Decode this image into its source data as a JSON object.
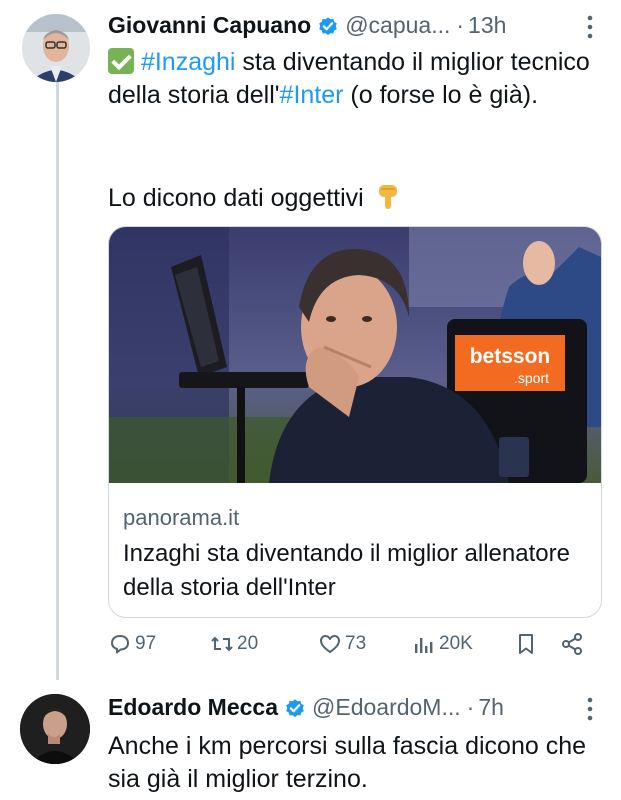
{
  "tweet": {
    "author_name": "Giovanni Capuano",
    "handle": "@capua...",
    "separator": "·",
    "time": "13h",
    "text": {
      "hashtag1": "#Inzaghi",
      "part1": " sta diventando il miglior tecnico della storia dell'",
      "hashtag2": "#Inter",
      "part2": " (o forse lo è già).",
      "line2": "Lo dicono dati oggettivi"
    },
    "card": {
      "image_badge": "betsson",
      "image_badge_sub": ".sport",
      "domain": "panorama.it",
      "title": "Inzaghi sta diventando il miglior allenatore della storia dell'Inter"
    },
    "actions": {
      "replies": "97",
      "retweets": "20",
      "likes": "73",
      "views": "20K"
    }
  },
  "reply": {
    "author_name": "Edoardo Mecca",
    "handle": "@EdoardoM...",
    "separator": "·",
    "time": "7h",
    "text": "Anche i km percorsi sulla fascia dicono che sia già il miglior terzino."
  },
  "colors": {
    "accent": "#1d9bf0",
    "muted": "#536471",
    "verified": "#1d9bf0",
    "check_emoji": "#77b255",
    "betsson_orange": "#f26b21"
  },
  "icons": [
    "verified-badge-icon",
    "more-options-icon",
    "check-mark-emoji-icon",
    "pointing-down-emoji-icon",
    "reply-icon",
    "retweet-icon",
    "like-icon",
    "views-icon",
    "bookmark-icon",
    "share-icon"
  ]
}
